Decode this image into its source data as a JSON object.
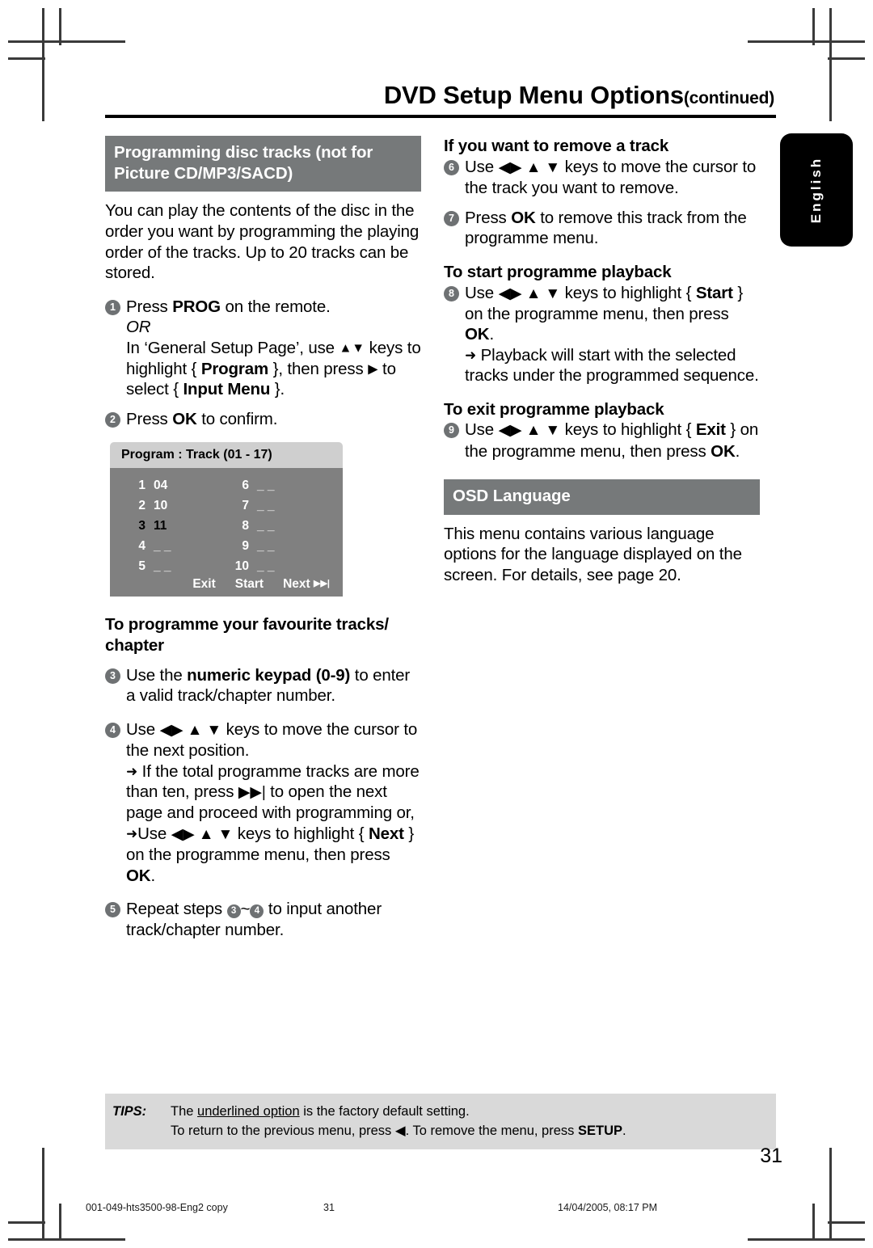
{
  "header": {
    "title": "DVD Setup Menu Options",
    "continued": "(continued)"
  },
  "language_tab": {
    "label": "English"
  },
  "left_column": {
    "section_heading": "Programming disc tracks (not for Picture CD/MP3/SACD)",
    "intro": "You can play the contents of the disc in the order you want by programming the playing order of the tracks. Up to 20 tracks can be stored.",
    "step1": {
      "num": "1",
      "line1_pre": "Press ",
      "line1_bold": "PROG",
      "line1_post": " on the remote.",
      "or": "OR",
      "line2_pre": "In ‘General Setup Page’, use ",
      "line2_keys": "▲▼",
      "line2_mid": " keys to highlight { ",
      "line2_bold1": "Program",
      "line2_mid2": " }, then press ",
      "line2_key2": "▶",
      "line2_mid3": " to select { ",
      "line2_bold2": "Input Menu",
      "line2_end": " }."
    },
    "step2": {
      "num": "2",
      "pre": "Press ",
      "bold": "OK",
      "post": " to confirm."
    },
    "osd": {
      "title": "Program : Track (01 - 17)",
      "entries_left": [
        {
          "index": "1",
          "value": "04",
          "selected": false
        },
        {
          "index": "2",
          "value": "10",
          "selected": false
        },
        {
          "index": "3",
          "value": "11",
          "selected": true
        },
        {
          "index": "4",
          "value": "_ _",
          "selected": false
        },
        {
          "index": "5",
          "value": "_ _",
          "selected": false
        }
      ],
      "entries_right": [
        {
          "index": "6",
          "value": "_ _",
          "selected": false
        },
        {
          "index": "7",
          "value": "_ _",
          "selected": false
        },
        {
          "index": "8",
          "value": "_ _",
          "selected": false
        },
        {
          "index": "9",
          "value": "_ _",
          "selected": false
        },
        {
          "index": "10",
          "value": "_ _",
          "selected": false
        }
      ],
      "buttons": {
        "exit": "Exit",
        "start": "Start",
        "next": "Next"
      }
    },
    "subhead_favourite": "To programme your favourite tracks/ chapter",
    "step3": {
      "num": "3",
      "pre": "Use the ",
      "bold": "numeric keypad (0-9)",
      "post": " to enter a valid track/chapter number."
    },
    "step4": {
      "num": "4",
      "pre": "Use ",
      "keys": "◀▶ ▲ ▼",
      "post": " keys to move the cursor to the next position.",
      "bullet1_pre": "If the total programme tracks are more than ten, press ",
      "bullet1_key": "▶▶|",
      "bullet1_post": " to open the next page and proceed with programming or,",
      "bullet2_pre": "Use ",
      "bullet2_keys": "◀▶ ▲ ▼",
      "bullet2_mid": " keys to highlight { ",
      "bullet2_bold": "Next",
      "bullet2_mid2": " } on the programme menu, then press ",
      "bullet2_bold2": "OK",
      "bullet2_end": "."
    },
    "step5": {
      "num": "5",
      "pre": "Repeat steps ",
      "ref_from": "3",
      "tilde": "~",
      "ref_to": "4",
      "post": " to input another track/chapter number."
    }
  },
  "right_column": {
    "subhead_remove": "If you want to remove a track",
    "step6": {
      "num": "6",
      "pre": "Use ",
      "keys": "◀▶ ▲ ▼",
      "post": " keys to move the cursor to the track you want to remove."
    },
    "step7": {
      "num": "7",
      "pre": "Press ",
      "bold": "OK",
      "post": " to remove this track from the programme menu."
    },
    "subhead_start": "To start programme playback",
    "step8": {
      "num": "8",
      "pre": "Use ",
      "keys": "◀▶ ▲ ▼",
      "mid": " keys to highlight { ",
      "bold1": "Start",
      "mid2": " } on the programme menu, then press ",
      "bold2": "OK",
      "end": ".",
      "bullet": "Playback will start with the selected tracks under the programmed sequence."
    },
    "subhead_exit": "To exit programme playback",
    "step9": {
      "num": "9",
      "pre": "Use ",
      "keys": "◀▶ ▲ ▼",
      "mid": " keys to highlight { ",
      "bold1": "Exit",
      "mid2": " } on the programme menu, then press ",
      "bold2": "OK",
      "end": "."
    },
    "section_heading_osd": "OSD Language",
    "osd_text": "This menu contains various language options for the language displayed on the screen.  For details, see page 20."
  },
  "tips": {
    "label": "TIPS:",
    "line1_pre": "The ",
    "line1_underline": "underlined option",
    "line1_post": " is the factory default setting.",
    "line2_pre": "To return to the previous menu, press ",
    "line2_key": "◀",
    "line2_mid": ". To remove the menu, press ",
    "line2_bold": "SETUP",
    "line2_end": "."
  },
  "page_number": "31",
  "print_footer": {
    "file": "001-049-hts3500-98-Eng2 copy",
    "page": "31",
    "date": "14/04/2005, 08:17 PM"
  },
  "colors": {
    "section_bar": "#76797a",
    "osd_title_bg": "#cfcfcf",
    "osd_body_bg": "#808080",
    "tips_bg": "#d9d9d9",
    "bullet_circle": "#6e7173"
  }
}
